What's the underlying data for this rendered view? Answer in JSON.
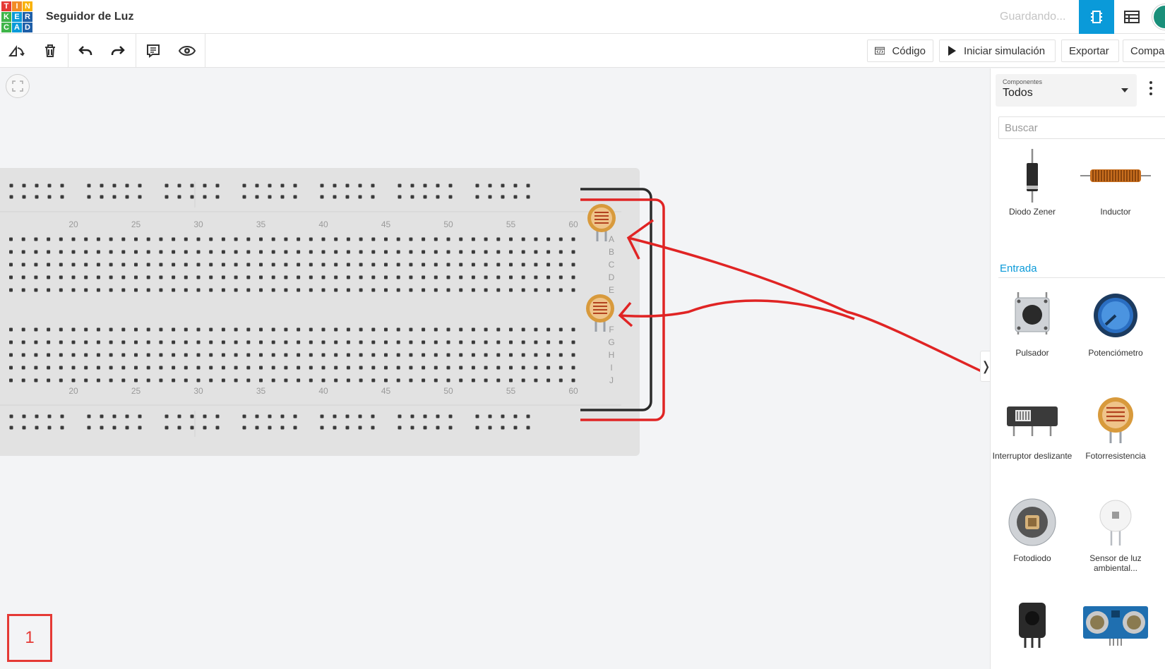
{
  "header": {
    "logo_letters": [
      "T",
      "I",
      "N",
      "K",
      "E",
      "R",
      "C",
      "A",
      "D"
    ],
    "logo_colors": [
      "#e53935",
      "#f28c28",
      "#f9b208",
      "#3fb549",
      "#0a9ad9",
      "#1f5fa8",
      "#3fb549",
      "#0a9ad9",
      "#1f5fa8"
    ],
    "project_title": "Seguidor de Luz",
    "saving_status": "Guardando...",
    "accent_color": "#0a9ad9"
  },
  "toolbar": {
    "code_label": "Código",
    "simulate_label": "Iniciar simulación",
    "export_label": "Exportar",
    "share_label": "Compar"
  },
  "breadboard": {
    "column_numbers": [
      "20",
      "25",
      "30",
      "35",
      "40",
      "45",
      "50",
      "55",
      "60"
    ],
    "row_letters_top": [
      "A",
      "B",
      "C",
      "D",
      "E"
    ],
    "row_letters_bottom": [
      "F",
      "G",
      "H",
      "I",
      "J"
    ]
  },
  "page_indicator": "1",
  "panel": {
    "components_label": "Componentes",
    "components_value": "Todos",
    "search_placeholder": "Buscar",
    "section_input": "Entrada",
    "items": [
      {
        "label": "Diodo Zener",
        "icon": "zener-diode-icon"
      },
      {
        "label": "Inductor",
        "icon": "inductor-icon"
      },
      {
        "label": "Pulsador",
        "icon": "pushbutton-icon"
      },
      {
        "label": "Potenciómetro",
        "icon": "potentiometer-icon"
      },
      {
        "label": "Interruptor deslizante",
        "icon": "slide-switch-icon"
      },
      {
        "label": "Fotorresistencia",
        "icon": "photoresistor-icon"
      },
      {
        "label": "Fotodiodo",
        "icon": "photodiode-icon"
      },
      {
        "label": "Sensor de luz ambiental...",
        "icon": "ambient-light-sensor-icon"
      },
      {
        "label": "",
        "icon": "ir-receiver-icon"
      },
      {
        "label": "",
        "icon": "ultrasonic-sensor-icon"
      }
    ]
  },
  "colors": {
    "annotation_red": "#e53935",
    "breadboard": "#e2e2e2",
    "photoresistor": "#d89a3c"
  }
}
